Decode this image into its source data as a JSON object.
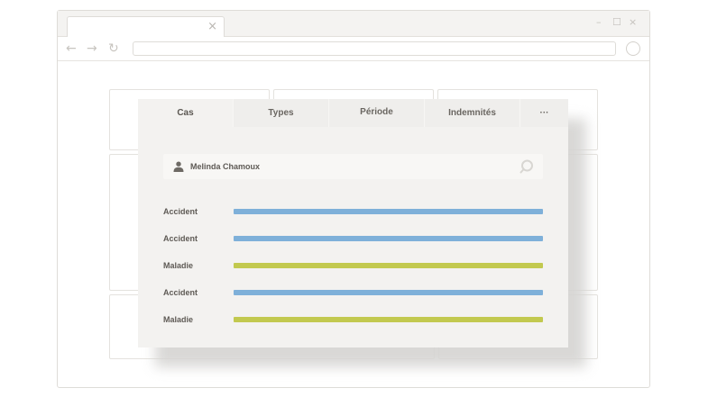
{
  "browser": {
    "tab_close_glyph": "×",
    "window_controls": [
      "–",
      "☐",
      "×"
    ],
    "nav": {
      "back_glyph": "←",
      "forward_glyph": "→",
      "reload_glyph": "↻"
    },
    "url": ""
  },
  "panel": {
    "tabs": [
      {
        "label": "Cas",
        "active": true
      },
      {
        "label": "Types",
        "active": false
      },
      {
        "label": "Période",
        "active": false
      },
      {
        "label": "Indemnités",
        "active": false
      },
      {
        "label": "···",
        "active": false
      }
    ],
    "search": {
      "icon": "user-icon",
      "value": "Melinda Chamoux",
      "search_icon": "search-icon"
    },
    "rows": [
      {
        "label": "Accident",
        "color": "#7eb0d9"
      },
      {
        "label": "Accident",
        "color": "#7eb0d9"
      },
      {
        "label": "Maladie",
        "color": "#c2c94f"
      },
      {
        "label": "Accident",
        "color": "#7eb0d9"
      },
      {
        "label": "Maladie",
        "color": "#c2c94f"
      }
    ]
  }
}
